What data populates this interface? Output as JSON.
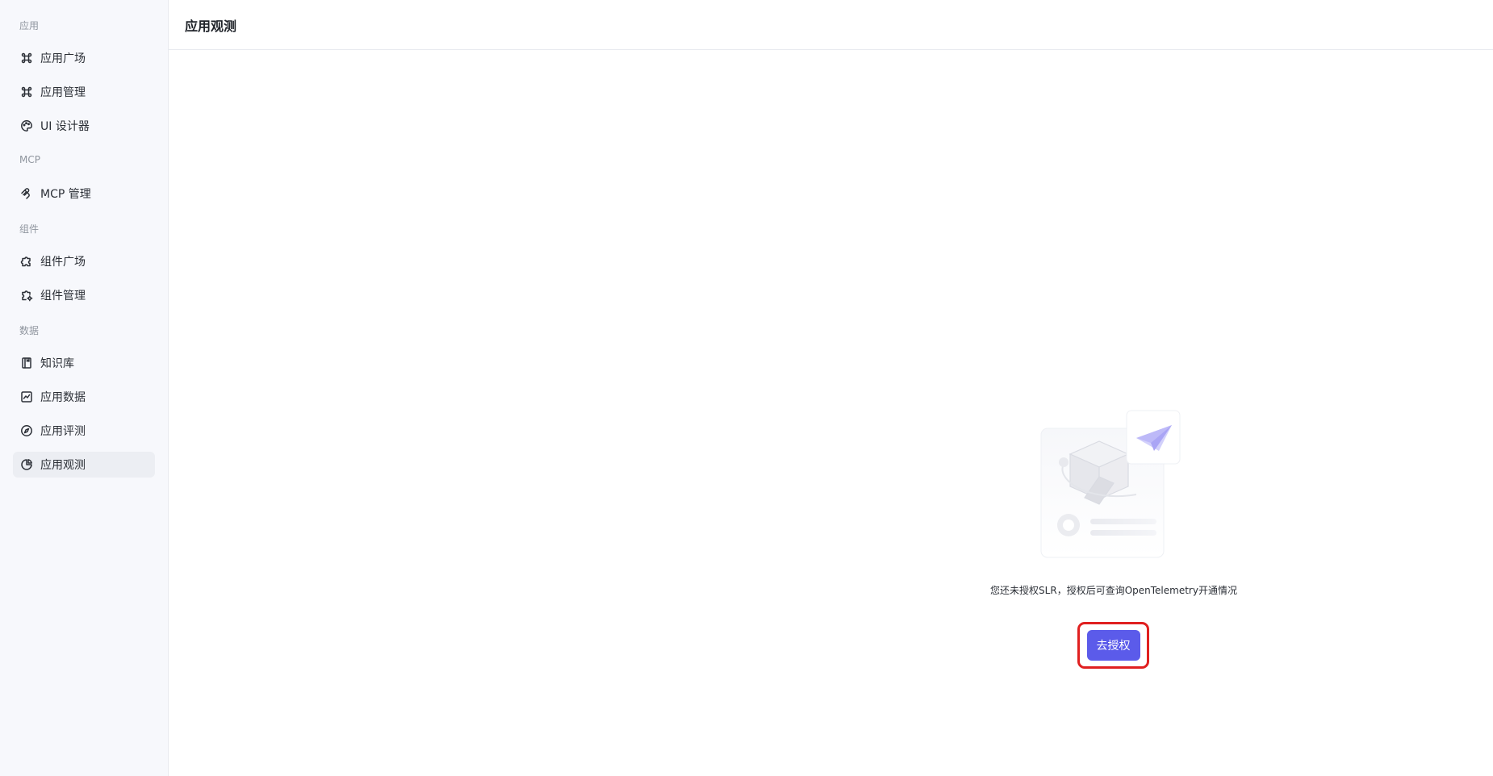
{
  "sidebar": {
    "sections": [
      {
        "title": "应用",
        "items": [
          {
            "label": "应用广场",
            "icon": "command-icon"
          },
          {
            "label": "应用管理",
            "icon": "command-icon"
          },
          {
            "label": "UI 设计器",
            "icon": "palette-icon"
          }
        ]
      },
      {
        "title": "MCP",
        "items": [
          {
            "label": "MCP 管理",
            "icon": "mcp-icon"
          }
        ]
      },
      {
        "title": "组件",
        "items": [
          {
            "label": "组件广场",
            "icon": "puzzle-icon"
          },
          {
            "label": "组件管理",
            "icon": "puzzle-gear-icon"
          }
        ]
      },
      {
        "title": "数据",
        "items": [
          {
            "label": "知识库",
            "icon": "book-icon"
          },
          {
            "label": "应用数据",
            "icon": "chart-line-icon"
          },
          {
            "label": "应用评测",
            "icon": "compass-icon"
          },
          {
            "label": "应用观测",
            "icon": "pie-chart-icon",
            "active": true
          }
        ]
      }
    ]
  },
  "header": {
    "title": "应用观测"
  },
  "empty_state": {
    "message": "您还未授权SLR，授权后可查询OpenTelemetry开通情况",
    "button_label": "去授权",
    "accent_color": "#5b5bea",
    "highlight_color": "#e02020"
  }
}
